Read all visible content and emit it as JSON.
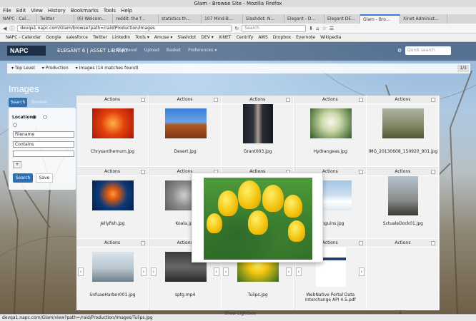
{
  "browser": {
    "window_title": "Glam - Browse Site - Mozilla Firefox",
    "menu": [
      "File",
      "Edit",
      "View",
      "History",
      "Bookmarks",
      "Tools",
      "Help"
    ],
    "tabs": [
      "NAPC - Cal…",
      "Twitter",
      "(6) Welcom…",
      "reddit: the f…",
      "statistics th…",
      "107 Mind-B…",
      "Slashdot: N…",
      "Elegant - D…",
      "Elegant DE…",
      "Glam - Bro…",
      "Xinet Administ…"
    ],
    "active_tab": 9,
    "url": "devqa1.napc.com/Glam/browse?path=/raid/Production/Images",
    "search_placeholder": "Search",
    "bookmarks": [
      "NAPC - Calendar",
      "Google",
      "salesforce",
      "Twitter",
      "LinkedIn",
      "Tools ▾",
      "Amuse ▾",
      "Slashdot",
      "DEV ▾",
      "XINET",
      "Centrify",
      "AWS",
      "Dropbox",
      "Evernote",
      "Wikipedia"
    ],
    "status_url": "devqa1.napc.com/Glam/view?path=/raid/Production/Images/Tulips.jpg",
    "footer_link": "Show Lightbox"
  },
  "app": {
    "logo": "NAPC",
    "title": "ELEGANT 6 | ASSET LIBRARY",
    "nav": [
      "Top Level",
      "Upload",
      "Basket",
      "Preferences ▾"
    ],
    "quick_search_placeholder": "Quick search",
    "breadcrumbs": [
      "▾ Top Level",
      "▾ Production",
      "▾ Images (14 matches found)"
    ],
    "page_count": "1/1",
    "heading": "Images",
    "search_tab": "Search",
    "browse_tab": "Browse",
    "location_label": "Location:",
    "filter_field": "Filename",
    "filter_op": "Contains",
    "plus_label": "+",
    "search_button": "Search",
    "save_button": "Save",
    "actions_label": "Actions",
    "files": [
      "Chrysanthemum.jpg",
      "Desert.jpg",
      "Grant003.jpg",
      "Hydrangeas.jpg",
      "IMG_20130608_150920_901.jpg",
      "Jellyfish.jpg",
      "Koala.jpg",
      "",
      "Penguins.jpg",
      "SctualeDock01.jpg",
      "SnfuaeHarbor001.jpg",
      "sptg.mp4",
      "Tulips.jpg",
      "WebNative Portal Data Interchange API 4.5.pdf",
      ""
    ]
  },
  "colors": {
    "accent": "#2d6fb5",
    "header": "#1d2f46"
  }
}
